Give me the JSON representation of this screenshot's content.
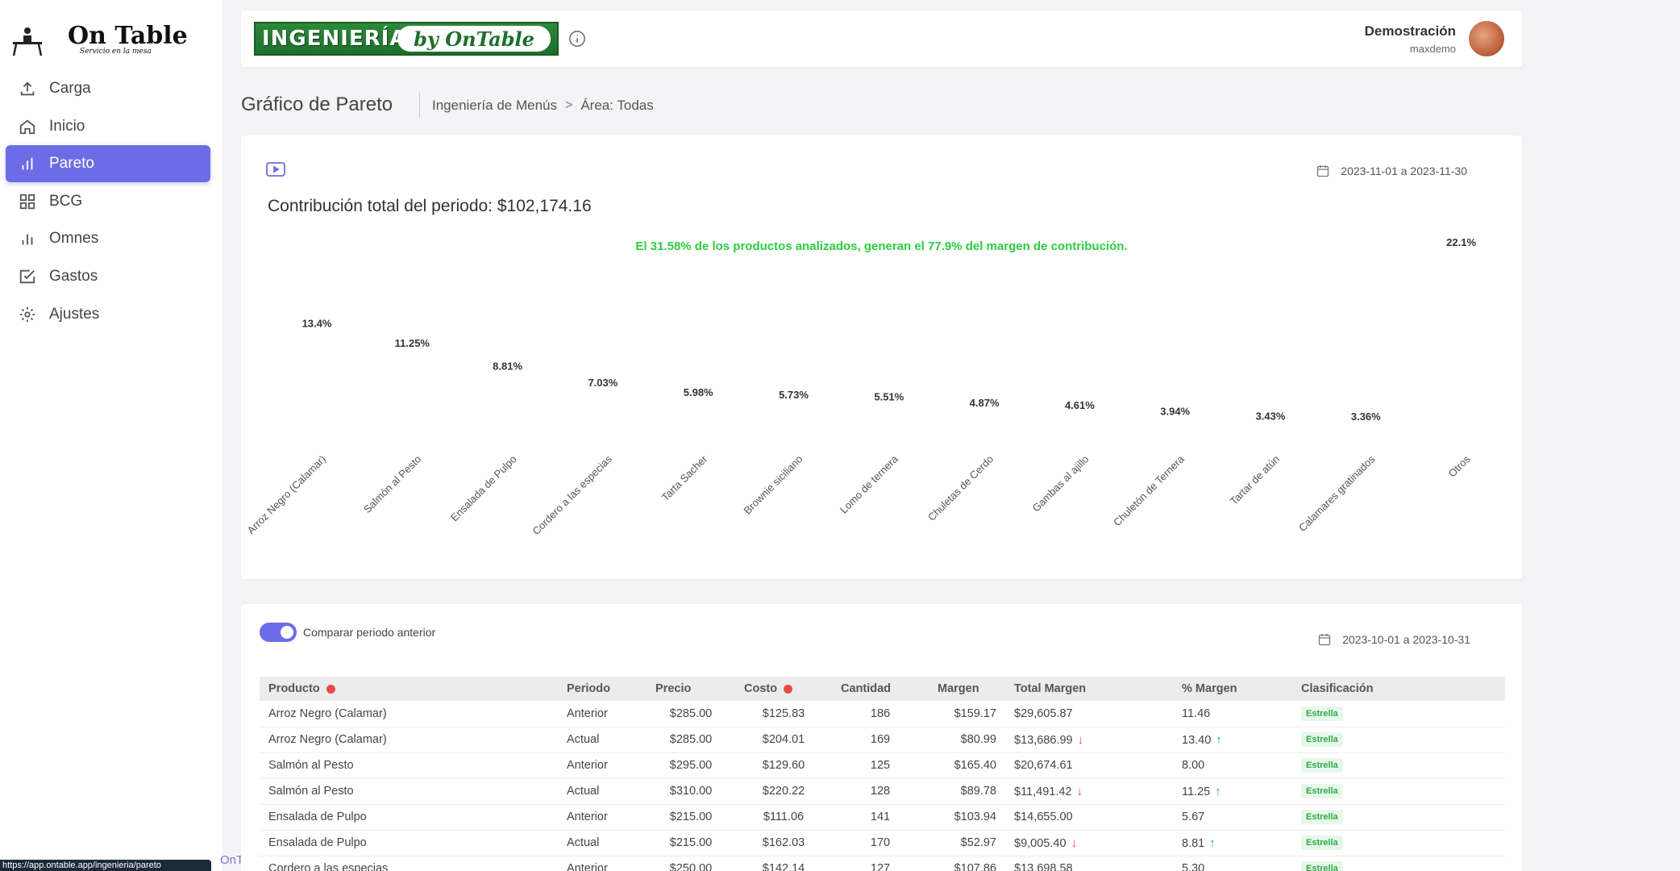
{
  "sidebar": {
    "logo_text": "On Table",
    "logo_sub": "Servicio en la mesa",
    "items": [
      {
        "label": "Carga",
        "icon": "upload-icon"
      },
      {
        "label": "Inicio",
        "icon": "home-icon"
      },
      {
        "label": "Pareto",
        "icon": "bar-chart-icon",
        "active": true
      },
      {
        "label": "BCG",
        "icon": "grid-icon"
      },
      {
        "label": "Omnes",
        "icon": "bar-chart-icon"
      },
      {
        "label": "Gastos",
        "icon": "checkbox-icon"
      },
      {
        "label": "Ajustes",
        "icon": "gear-icon"
      }
    ],
    "status_url": "https://app.ontable.app/ingenieria/pareto",
    "status_sub": "OnT"
  },
  "header": {
    "banner_left": "INGENIERÍA",
    "banner_right": "by OnTable",
    "user_name": "Demostración",
    "user_handle": "maxdemo"
  },
  "page": {
    "title": "Gráfico de Pareto",
    "breadcrumb_1": "Ingeniería de Menús",
    "breadcrumb_sep": ">",
    "breadcrumb_2": "Área: Todas"
  },
  "chart_card": {
    "date_range": "2023-11-01 a 2023-11-30",
    "heading": "Contribución total del periodo: $102,174.16",
    "summary": "El 31.58% de los productos analizados, generan el 77.9% del margen de contribución."
  },
  "chart_data": {
    "type": "bar",
    "categories": [
      "Arroz Negro (Calamar)",
      "Salmón al Pesto",
      "Ensalada de Pulpo",
      "Cordero a las especias",
      "Tarta Sacher",
      "Brownie siciliano",
      "Lomo de ternera",
      "Chuletas de Cerdo",
      "Gambas al ajillo",
      "Chuletón de Ternera",
      "Tartar de atún",
      "Calamares gratinados",
      "Otros"
    ],
    "values": [
      13.4,
      11.25,
      8.81,
      7.03,
      5.98,
      5.73,
      5.51,
      4.87,
      4.61,
      3.94,
      3.43,
      3.36,
      22.1
    ],
    "labels": [
      "13.4%",
      "11.25%",
      "8.81%",
      "7.03%",
      "5.98%",
      "5.73%",
      "5.51%",
      "4.87%",
      "4.61%",
      "3.94%",
      "3.43%",
      "3.36%",
      "22.1%"
    ],
    "bar_colors_visible": false
  },
  "table_card": {
    "toggle_label": "Comparar periodo anterior",
    "toggle_on": true,
    "date_range": "2023-10-01 a 2023-10-31",
    "columns": [
      "Producto",
      "Periodo",
      "Precio",
      "Costo",
      "Cantidad",
      "Margen",
      "Total Margen",
      "% Margen",
      "Clasificación"
    ],
    "rows": [
      {
        "producto": "Arroz Negro (Calamar)",
        "periodo": "Anterior",
        "precio": "$285.00",
        "costo": "$125.83",
        "cantidad": "186",
        "margen": "$159.17",
        "total": "$29,605.87",
        "total_arrow": "",
        "pct": "11.46",
        "pct_arrow": "",
        "clasif": "Estrella"
      },
      {
        "producto": "Arroz Negro (Calamar)",
        "periodo": "Actual",
        "precio": "$285.00",
        "costo": "$204.01",
        "cantidad": "169",
        "margen": "$80.99",
        "total": "$13,686.99",
        "total_arrow": "down",
        "pct": "13.40",
        "pct_arrow": "up",
        "clasif": "Estrella"
      },
      {
        "producto": "Salmón al Pesto",
        "periodo": "Anterior",
        "precio": "$295.00",
        "costo": "$129.60",
        "cantidad": "125",
        "margen": "$165.40",
        "total": "$20,674.61",
        "total_arrow": "",
        "pct": "8.00",
        "pct_arrow": "",
        "clasif": "Estrella"
      },
      {
        "producto": "Salmón al Pesto",
        "periodo": "Actual",
        "precio": "$310.00",
        "costo": "$220.22",
        "cantidad": "128",
        "margen": "$89.78",
        "total": "$11,491.42",
        "total_arrow": "down",
        "pct": "11.25",
        "pct_arrow": "up",
        "clasif": "Estrella"
      },
      {
        "producto": "Ensalada de Pulpo",
        "periodo": "Anterior",
        "precio": "$215.00",
        "costo": "$111.06",
        "cantidad": "141",
        "margen": "$103.94",
        "total": "$14,655.00",
        "total_arrow": "",
        "pct": "5.67",
        "pct_arrow": "",
        "clasif": "Estrella"
      },
      {
        "producto": "Ensalada de Pulpo",
        "periodo": "Actual",
        "precio": "$215.00",
        "costo": "$162.03",
        "cantidad": "170",
        "margen": "$52.97",
        "total": "$9,005.40",
        "total_arrow": "down",
        "pct": "8.81",
        "pct_arrow": "up",
        "clasif": "Estrella"
      },
      {
        "producto": "Cordero a las especias",
        "periodo": "Anterior",
        "precio": "$250.00",
        "costo": "$142.14",
        "cantidad": "127",
        "margen": "$107.86",
        "total": "$13,698.58",
        "total_arrow": "",
        "pct": "5.30",
        "pct_arrow": "",
        "clasif": "Estrella"
      }
    ]
  }
}
